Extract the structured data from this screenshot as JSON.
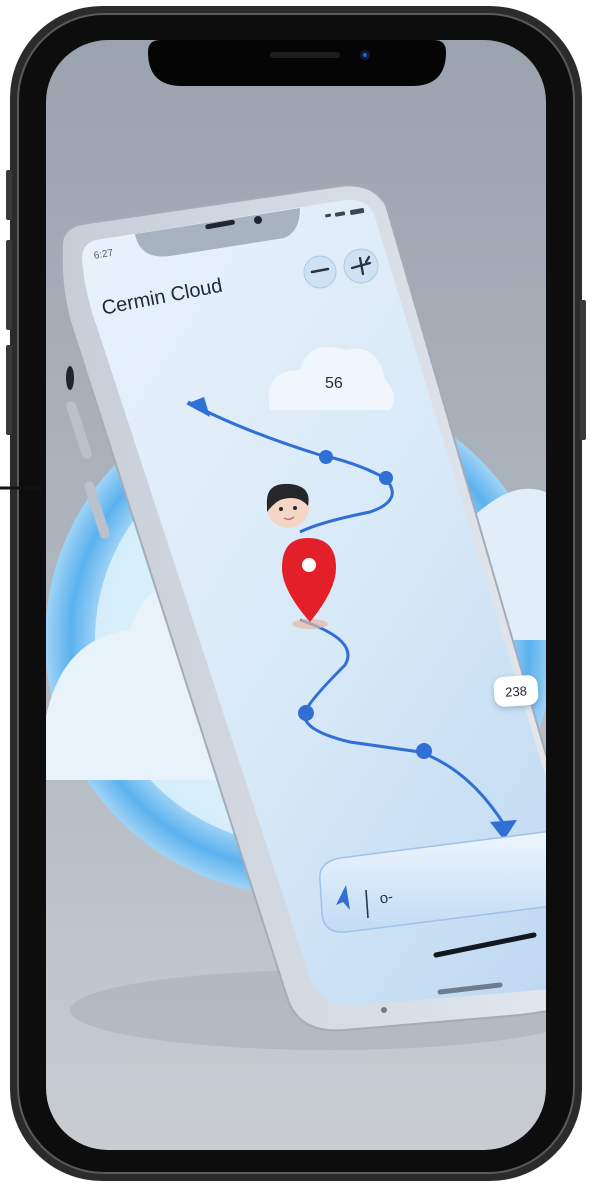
{
  "app": {
    "title": "Cermin Cloud",
    "status_time": "ნ:Ƨ ",
    "status_time_display": "6:27"
  },
  "map": {
    "cloud_badge": "56",
    "distance_badge": "238"
  },
  "search": {
    "value": "o-"
  },
  "icons": {
    "top_left_button": "minus-icon",
    "top_right_button": "plane-icon",
    "search_leading": "navigation-arrow-icon",
    "location_pin": "map-pin-icon",
    "avatar": "person-avatar-icon"
  },
  "colors": {
    "route": "#2f6fd6",
    "pin": "#e3202a",
    "screen_bg": "#dcebf8",
    "phone_frame": "#1a1a1a"
  }
}
